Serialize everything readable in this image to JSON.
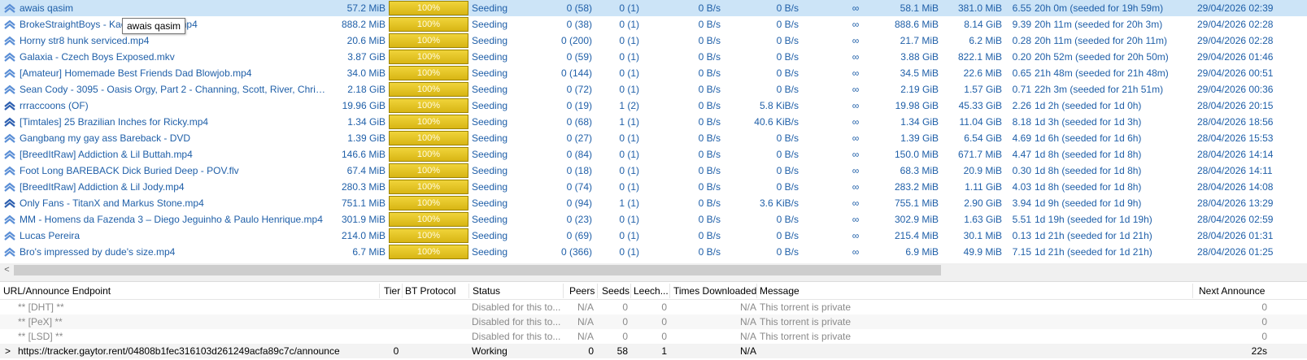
{
  "tooltip": "awais qasim",
  "colors": {
    "selected_row": "#cce4f7",
    "text_link": "#1f5fa8",
    "progress_fill": "#e3c021"
  },
  "torrents": [
    {
      "name": "awais qasim",
      "size": "57.2 MiB",
      "progress_label": "100%",
      "progress": 1.0,
      "status": "Seeding",
      "seeds": "0 (58)",
      "peers": "0 (1)",
      "down_speed": "0 B/s",
      "up_speed": "0 B/s",
      "eta": "∞",
      "downloaded": "58.1 MiB",
      "uploaded": "381.0 MiB",
      "ratio": "6.55",
      "seeding_time": "20h 0m (seeded for 19h 59m)",
      "added_on": "29/04/2026 02:39",
      "icon": "seeding-up-arrows-icon"
    },
    {
      "name": "BrokeStraightBoys - Kace Kai White.mp4",
      "size": "888.2 MiB",
      "progress_label": "100%",
      "progress": 1.0,
      "status": "Seeding",
      "seeds": "0 (38)",
      "peers": "0 (1)",
      "down_speed": "0 B/s",
      "up_speed": "0 B/s",
      "eta": "∞",
      "downloaded": "888.6 MiB",
      "uploaded": "8.14 GiB",
      "ratio": "9.39",
      "seeding_time": "20h 11m (seeded for 20h 3m)",
      "added_on": "29/04/2026 02:28",
      "icon": "seeding-up-arrows-icon"
    },
    {
      "name": "Horny str8 hunk serviced.mp4",
      "size": "20.6 MiB",
      "progress_label": "100%",
      "progress": 1.0,
      "status": "Seeding",
      "seeds": "0 (200)",
      "peers": "0 (1)",
      "down_speed": "0 B/s",
      "up_speed": "0 B/s",
      "eta": "∞",
      "downloaded": "21.7 MiB",
      "uploaded": "6.2 MiB",
      "ratio": "0.28",
      "seeding_time": "20h 11m (seeded for 20h 11m)",
      "added_on": "29/04/2026 02:28",
      "icon": "seeding-up-arrows-icon"
    },
    {
      "name": "Galaxia - Czech Boys Exposed.mkv",
      "size": "3.87 GiB",
      "progress_label": "100%",
      "progress": 1.0,
      "status": "Seeding",
      "seeds": "0 (59)",
      "peers": "0 (1)",
      "down_speed": "0 B/s",
      "up_speed": "0 B/s",
      "eta": "∞",
      "downloaded": "3.88 GiB",
      "uploaded": "822.1 MiB",
      "ratio": "0.20",
      "seeding_time": "20h 52m (seeded for 20h 50m)",
      "added_on": "29/04/2026 01:46",
      "icon": "seeding-up-arrows-icon"
    },
    {
      "name": "[Amateur] Homemade Best Friends Dad Blowjob.mp4",
      "size": "34.0 MiB",
      "progress_label": "100%",
      "progress": 1.0,
      "status": "Seeding",
      "seeds": "0 (144)",
      "peers": "0 (1)",
      "down_speed": "0 B/s",
      "up_speed": "0 B/s",
      "eta": "∞",
      "downloaded": "34.5 MiB",
      "uploaded": "22.6 MiB",
      "ratio": "0.65",
      "seeding_time": "21h 48m (seeded for 21h 48m)",
      "added_on": "29/04/2026 00:51",
      "icon": "seeding-up-arrows-icon"
    },
    {
      "name": "Sean Cody - 3095 - Oasis Orgy, Part 2 - Channing, Scott, River, Christo...",
      "size": "2.18 GiB",
      "progress_label": "100%",
      "progress": 1.0,
      "status": "Seeding",
      "seeds": "0 (72)",
      "peers": "0 (1)",
      "down_speed": "0 B/s",
      "up_speed": "0 B/s",
      "eta": "∞",
      "downloaded": "2.19 GiB",
      "uploaded": "1.57 GiB",
      "ratio": "0.71",
      "seeding_time": "22h 3m (seeded for 21h 51m)",
      "added_on": "29/04/2026 00:36",
      "icon": "seeding-up-arrows-icon"
    },
    {
      "name": "rrraccoons (OF)",
      "size": "19.96 GiB",
      "progress_label": "100%",
      "progress": 1.0,
      "status": "Seeding",
      "seeds": "0 (19)",
      "peers": "1 (2)",
      "down_speed": "0 B/s",
      "up_speed": "5.8 KiB/s",
      "eta": "∞",
      "downloaded": "19.98 GiB",
      "uploaded": "45.33 GiB",
      "ratio": "2.26",
      "seeding_time": "1d 2h (seeded for 1d 0h)",
      "added_on": "28/04/2026 20:15",
      "icon": "seeding-up-arrows-active-icon"
    },
    {
      "name": "[Timtales] 25 Brazilian Inches for Ricky.mp4",
      "size": "1.34 GiB",
      "progress_label": "100%",
      "progress": 1.0,
      "status": "Seeding",
      "seeds": "0 (68)",
      "peers": "1 (1)",
      "down_speed": "0 B/s",
      "up_speed": "40.6 KiB/s",
      "eta": "∞",
      "downloaded": "1.34 GiB",
      "uploaded": "11.04 GiB",
      "ratio": "8.18",
      "seeding_time": "1d 3h (seeded for 1d 3h)",
      "added_on": "28/04/2026 18:56",
      "icon": "seeding-up-arrows-active-icon"
    },
    {
      "name": "Gangbang my gay ass Bareback - DVD",
      "size": "1.39 GiB",
      "progress_label": "100%",
      "progress": 1.0,
      "status": "Seeding",
      "seeds": "0 (27)",
      "peers": "0 (1)",
      "down_speed": "0 B/s",
      "up_speed": "0 B/s",
      "eta": "∞",
      "downloaded": "1.39 GiB",
      "uploaded": "6.54 GiB",
      "ratio": "4.69",
      "seeding_time": "1d 6h (seeded for 1d 6h)",
      "added_on": "28/04/2026 15:53",
      "icon": "seeding-up-arrows-icon"
    },
    {
      "name": "[BreedItRaw] Addiction & Lil Buttah.mp4",
      "size": "146.6 MiB",
      "progress_label": "100%",
      "progress": 1.0,
      "status": "Seeding",
      "seeds": "0 (84)",
      "peers": "0 (1)",
      "down_speed": "0 B/s",
      "up_speed": "0 B/s",
      "eta": "∞",
      "downloaded": "150.0 MiB",
      "uploaded": "671.7 MiB",
      "ratio": "4.47",
      "seeding_time": "1d 8h (seeded for 1d 8h)",
      "added_on": "28/04/2026 14:14",
      "icon": "seeding-up-arrows-icon"
    },
    {
      "name": "Foot Long BAREBACK Dick Buried Deep - POV.flv",
      "size": "67.4 MiB",
      "progress_label": "100%",
      "progress": 1.0,
      "status": "Seeding",
      "seeds": "0 (18)",
      "peers": "0 (1)",
      "down_speed": "0 B/s",
      "up_speed": "0 B/s",
      "eta": "∞",
      "downloaded": "68.3 MiB",
      "uploaded": "20.9 MiB",
      "ratio": "0.30",
      "seeding_time": "1d 8h (seeded for 1d 8h)",
      "added_on": "28/04/2026 14:11",
      "icon": "seeding-up-arrows-icon"
    },
    {
      "name": "[BreedItRaw] Addiction & Lil Jody.mp4",
      "size": "280.3 MiB",
      "progress_label": "100%",
      "progress": 1.0,
      "status": "Seeding",
      "seeds": "0 (74)",
      "peers": "0 (1)",
      "down_speed": "0 B/s",
      "up_speed": "0 B/s",
      "eta": "∞",
      "downloaded": "283.2 MiB",
      "uploaded": "1.11 GiB",
      "ratio": "4.03",
      "seeding_time": "1d 8h (seeded for 1d 8h)",
      "added_on": "28/04/2026 14:08",
      "icon": "seeding-up-arrows-icon"
    },
    {
      "name": "Only Fans - TitanX and Markus Stone.mp4",
      "size": "751.1 MiB",
      "progress_label": "100%",
      "progress": 1.0,
      "status": "Seeding",
      "seeds": "0 (94)",
      "peers": "1 (1)",
      "down_speed": "0 B/s",
      "up_speed": "3.6 KiB/s",
      "eta": "∞",
      "downloaded": "755.1 MiB",
      "uploaded": "2.90 GiB",
      "ratio": "3.94",
      "seeding_time": "1d 9h (seeded for 1d 9h)",
      "added_on": "28/04/2026 13:29",
      "icon": "seeding-up-arrows-active-icon"
    },
    {
      "name": "MM - Homens da Fazenda 3 – Diego Jeguinho & Paulo Henrique.mp4",
      "size": "301.9 MiB",
      "progress_label": "100%",
      "progress": 1.0,
      "status": "Seeding",
      "seeds": "0 (23)",
      "peers": "0 (1)",
      "down_speed": "0 B/s",
      "up_speed": "0 B/s",
      "eta": "∞",
      "downloaded": "302.9 MiB",
      "uploaded": "1.63 GiB",
      "ratio": "5.51",
      "seeding_time": "1d 19h (seeded for 1d 19h)",
      "added_on": "28/04/2026 02:59",
      "icon": "seeding-up-arrows-icon"
    },
    {
      "name": "Lucas Pereira",
      "size": "214.0 MiB",
      "progress_label": "100%",
      "progress": 1.0,
      "status": "Seeding",
      "seeds": "0 (69)",
      "peers": "0 (1)",
      "down_speed": "0 B/s",
      "up_speed": "0 B/s",
      "eta": "∞",
      "downloaded": "215.4 MiB",
      "uploaded": "30.1 MiB",
      "ratio": "0.13",
      "seeding_time": "1d 21h (seeded for 1d 21h)",
      "added_on": "28/04/2026 01:31",
      "icon": "seeding-up-arrows-icon"
    },
    {
      "name": "Bro's impressed by dude's size.mp4",
      "size": "6.7 MiB",
      "progress_label": "100%",
      "progress": 1.0,
      "status": "Seeding",
      "seeds": "0 (366)",
      "peers": "0 (1)",
      "down_speed": "0 B/s",
      "up_speed": "0 B/s",
      "eta": "∞",
      "downloaded": "6.9 MiB",
      "uploaded": "49.9 MiB",
      "ratio": "7.15",
      "seeding_time": "1d 21h (seeded for 1d 21h)",
      "added_on": "28/04/2026 01:25",
      "icon": "seeding-up-arrows-icon"
    }
  ],
  "scrollbar": {
    "left_arrow": "<"
  },
  "trackers": {
    "headers": {
      "url": "URL/Announce Endpoint",
      "tier": "Tier",
      "protocol": "BT Protocol",
      "status": "Status",
      "peers": "Peers",
      "seeds": "Seeds",
      "leechers": "Leech...",
      "times_downloaded": "Times Downloaded",
      "message": "Message",
      "next_announce": "Next Announce"
    },
    "rows": [
      {
        "expand": "",
        "url": "** [DHT] **",
        "tier": "",
        "protocol": "",
        "status": "Disabled for this to...",
        "peers": "N/A",
        "seeds": "0",
        "leechers": "0",
        "times_downloaded": "N/A",
        "message": "This torrent is private",
        "next_announce": "0"
      },
      {
        "expand": "",
        "url": "** [PeX] **",
        "tier": "",
        "protocol": "",
        "status": "Disabled for this to...",
        "peers": "N/A",
        "seeds": "0",
        "leechers": "0",
        "times_downloaded": "N/A",
        "message": "This torrent is private",
        "next_announce": "0"
      },
      {
        "expand": "",
        "url": "** [LSD] **",
        "tier": "",
        "protocol": "",
        "status": "Disabled for this to...",
        "peers": "N/A",
        "seeds": "0",
        "leechers": "0",
        "times_downloaded": "N/A",
        "message": "This torrent is private",
        "next_announce": "0"
      },
      {
        "expand": ">",
        "url": "https://tracker.gaytor.rent/04808b1fec316103d261249acfa89c7c/announce",
        "tier": "0",
        "protocol": "",
        "status": "Working",
        "peers": "0",
        "seeds": "58",
        "leechers": "1",
        "times_downloaded": "N/A",
        "message": "",
        "next_announce": "22s"
      }
    ]
  }
}
